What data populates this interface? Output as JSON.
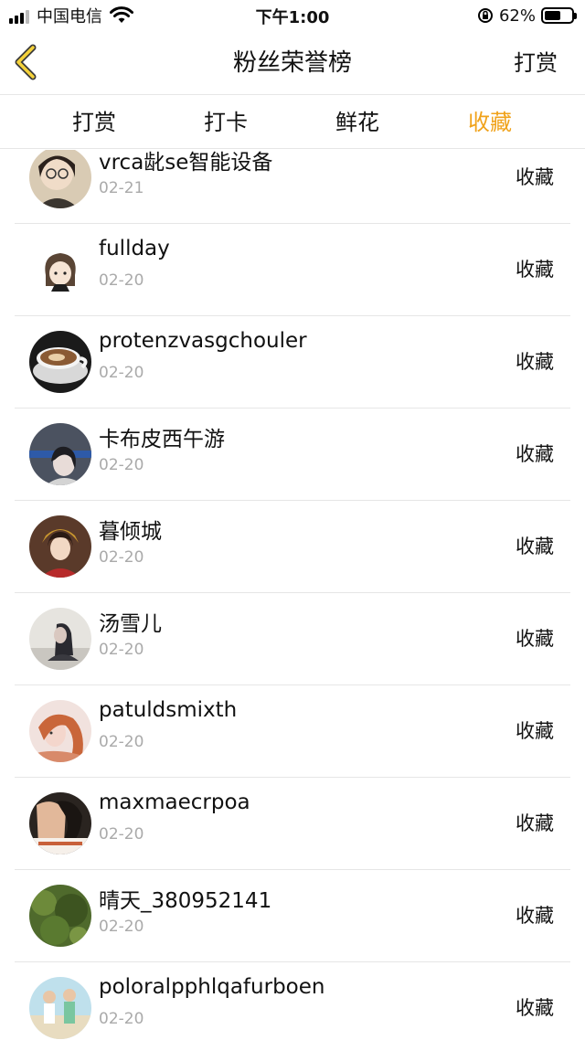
{
  "status_bar": {
    "carrier": "中国电信",
    "time": "下午1:00",
    "battery_percent": "62%",
    "battery_level": 0.62
  },
  "nav": {
    "back_icon": "chevron-left-icon",
    "title": "粉丝荣誉榜",
    "action": "打赏",
    "accent": "#f0a21a"
  },
  "tabs": [
    {
      "label": "打赏",
      "active": false
    },
    {
      "label": "打卡",
      "active": false
    },
    {
      "label": "鲜花",
      "active": false
    },
    {
      "label": "收藏",
      "active": true
    }
  ],
  "fans": [
    {
      "name": "vrca龀se智能设备",
      "date": "02-21",
      "action": "收藏"
    },
    {
      "name": "fullday",
      "date": "02-20",
      "action": "收藏"
    },
    {
      "name": "protenzvasgchouler",
      "date": "02-20",
      "action": "收藏"
    },
    {
      "name": "卡布皮西午游",
      "date": "02-20",
      "action": "收藏"
    },
    {
      "name": "暮倾城",
      "date": "02-20",
      "action": "收藏"
    },
    {
      "name": "汤雪儿",
      "date": "02-20",
      "action": "收藏"
    },
    {
      "name": "patuldsmixth",
      "date": "02-20",
      "action": "收藏"
    },
    {
      "name": "maxmaecrpoa",
      "date": "02-20",
      "action": "收藏"
    },
    {
      "name": "晴天_380952141",
      "date": "02-20",
      "action": "收藏"
    },
    {
      "name": "poloralpphlqafurboen",
      "date": "02-20",
      "action": "收藏"
    }
  ]
}
